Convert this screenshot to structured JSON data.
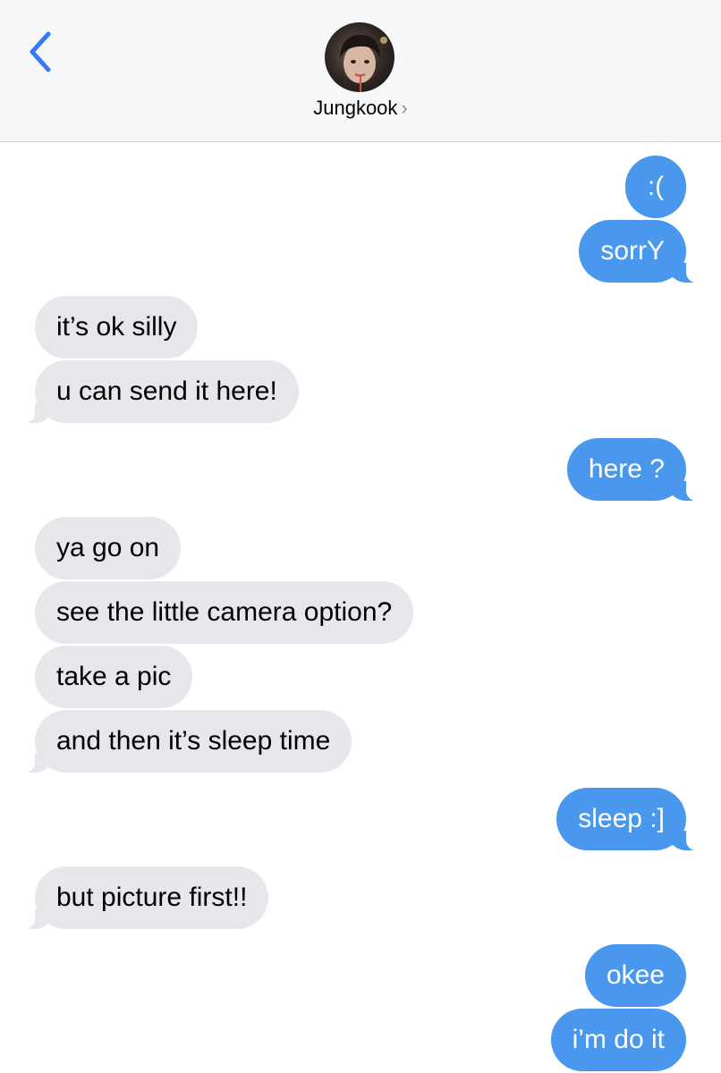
{
  "header": {
    "contact_name": "Jungkook",
    "chevron": "›",
    "back_icon": "chevron-left-icon",
    "accent_color": "#3478f6"
  },
  "messages": [
    {
      "direction": "outgoing",
      "text": ":("
    },
    {
      "direction": "outgoing",
      "text": "sorrY"
    },
    {
      "direction": "incoming",
      "text": "it’s ok silly"
    },
    {
      "direction": "incoming",
      "text": "u can send it here!"
    },
    {
      "direction": "outgoing",
      "text": "here ?"
    },
    {
      "direction": "incoming",
      "text": "ya go on"
    },
    {
      "direction": "incoming",
      "text": "see the little camera option?"
    },
    {
      "direction": "incoming",
      "text": "take a pic"
    },
    {
      "direction": "incoming",
      "text": "and then it’s sleep time"
    },
    {
      "direction": "outgoing",
      "text": "sleep :]"
    },
    {
      "direction": "incoming",
      "text": "but picture first!!"
    },
    {
      "direction": "outgoing",
      "text": "okee"
    },
    {
      "direction": "outgoing",
      "text": "i’m do it"
    }
  ],
  "colors": {
    "incoming_bubble": "#e6e6eb",
    "outgoing_bubble": "#4a98ee",
    "header_bg": "#f6f7f9"
  }
}
